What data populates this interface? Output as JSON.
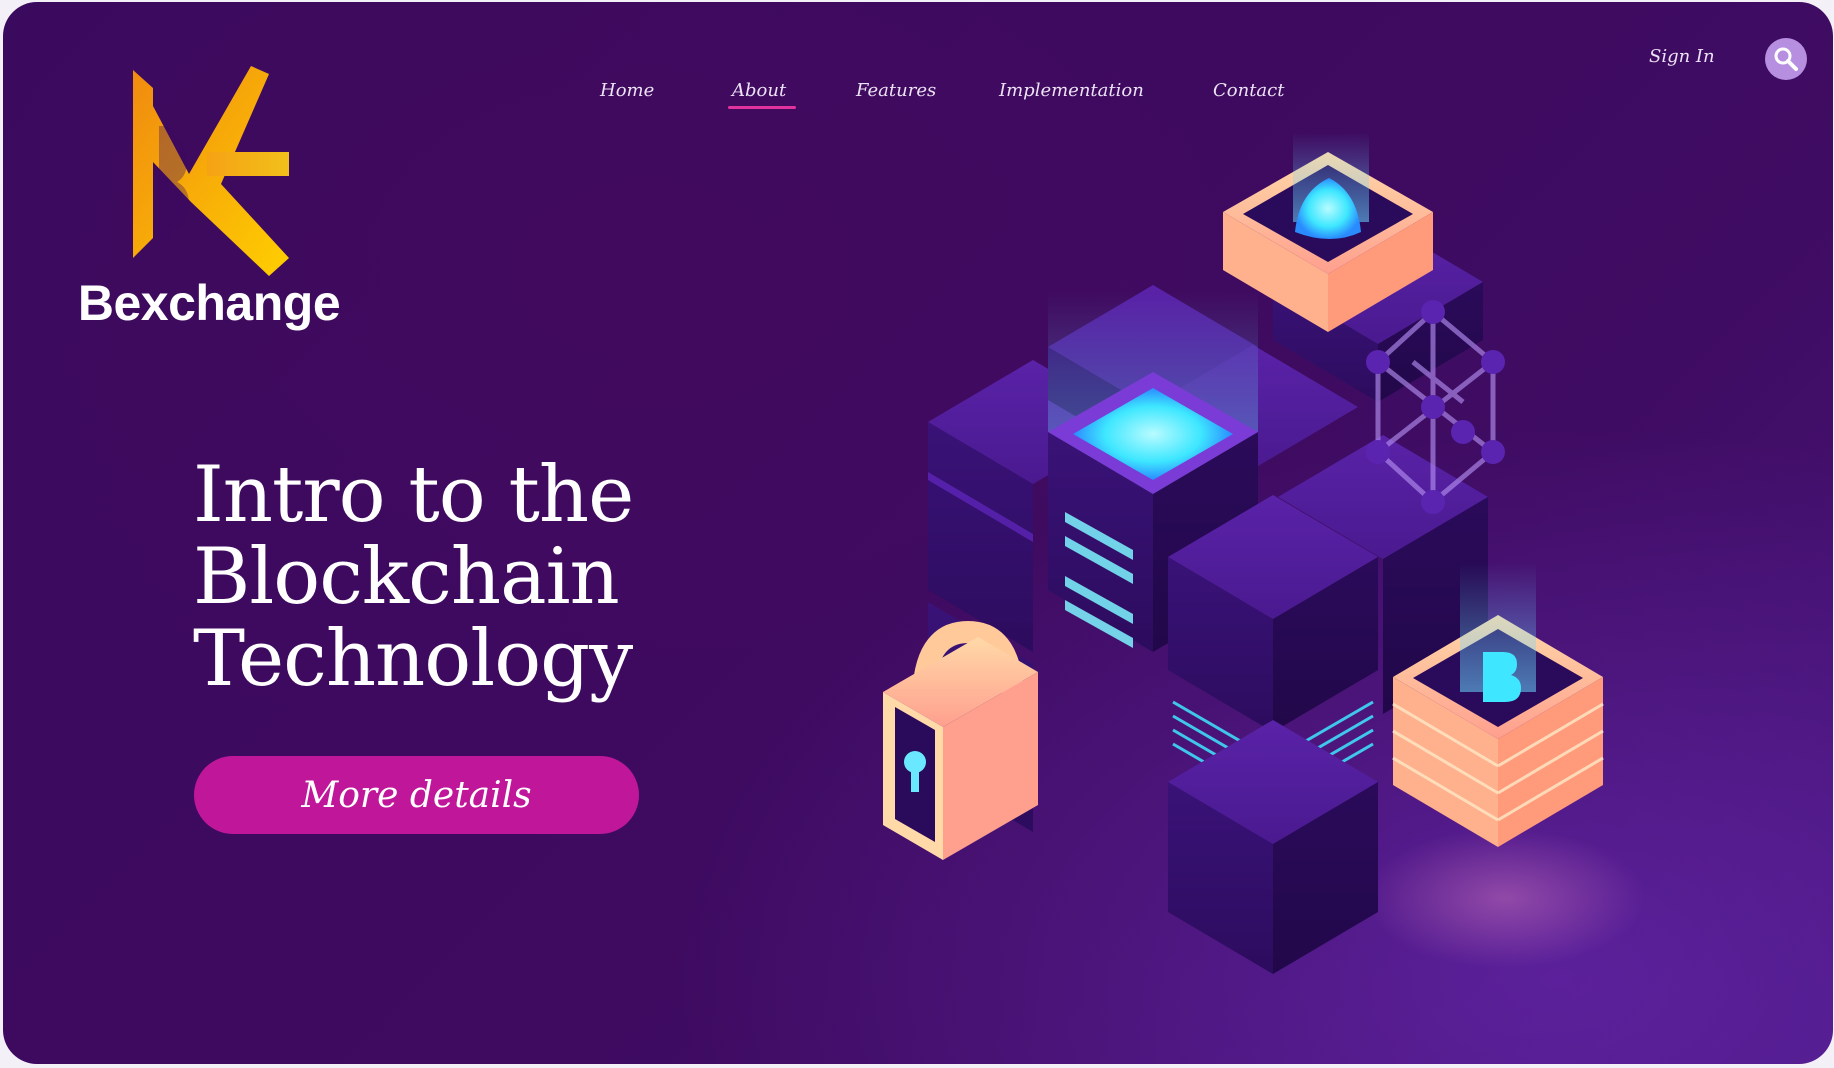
{
  "brand": {
    "name": "Bexchange"
  },
  "nav": {
    "items": [
      {
        "label": "Home"
      },
      {
        "label": "About"
      },
      {
        "label": "Features"
      },
      {
        "label": "Implementation"
      },
      {
        "label": "Contact"
      }
    ],
    "active": "About"
  },
  "header": {
    "signin_label": "Sign In",
    "search_icon": "search-icon"
  },
  "hero": {
    "title_lines": [
      "Intro to the",
      "Blockchain",
      "Technology"
    ],
    "cta_label": "More details"
  },
  "illustration": {
    "icons": [
      "server-cube-icon",
      "shield-icon",
      "padlock-icon",
      "bitcoin-icon",
      "network-graph-icon"
    ]
  },
  "colors": {
    "background": "#3d0a5f",
    "accent": "#c0169a",
    "nav_underline": "#e0339e",
    "logo_orange": "#f39a12",
    "logo_yellow": "#ffcf00",
    "glow": "#3ee7ff"
  }
}
